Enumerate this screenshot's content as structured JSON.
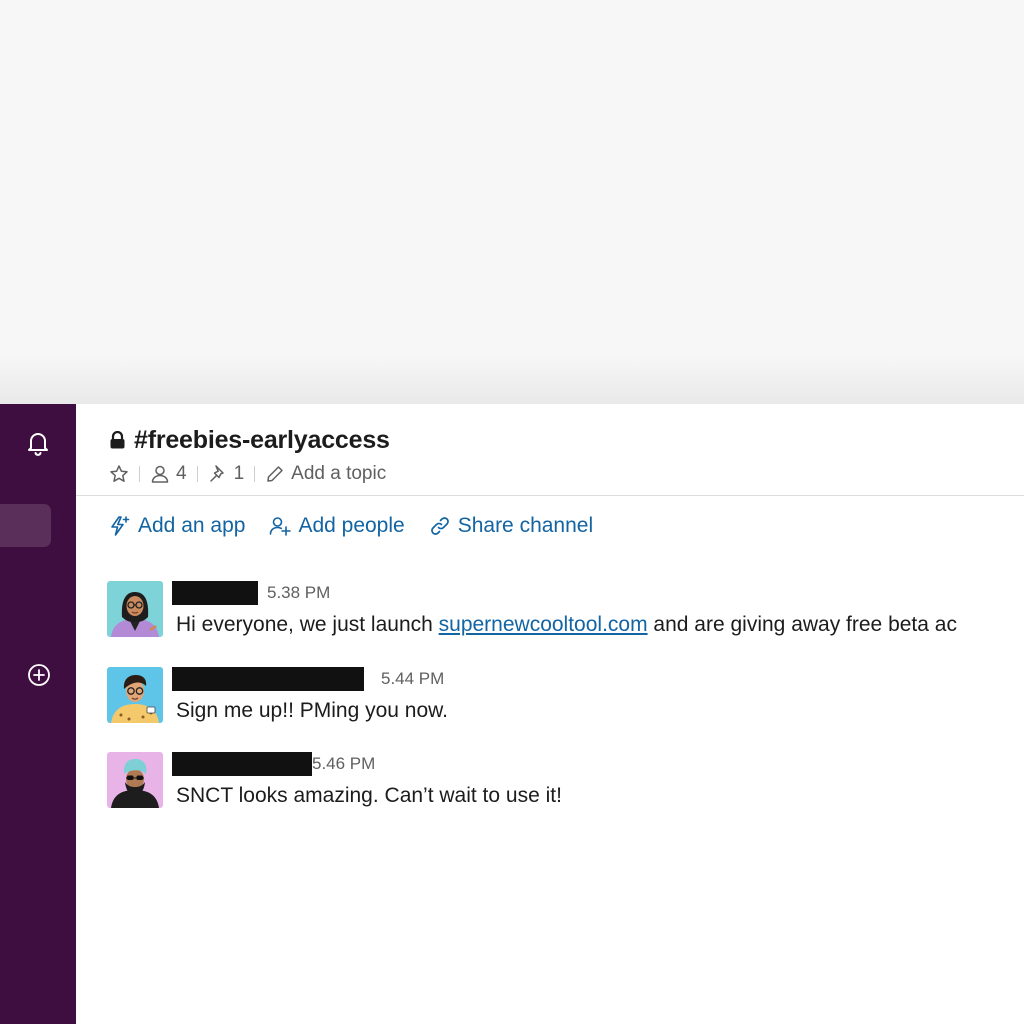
{
  "channel": {
    "name": "#freebies-earlyaccess",
    "member_count": "4",
    "pinned_count": "1",
    "topic_placeholder": "Add a topic"
  },
  "bookmarks": {
    "add_app": "Add an app",
    "add_people": "Add people",
    "share_channel": "Share channel"
  },
  "messages": [
    {
      "time": "5.38 PM",
      "text_before": "Hi everyone, we just launch ",
      "link": "supernewcooltool.com",
      "text_after": " and are giving away free beta ac"
    },
    {
      "time": "5.44 PM",
      "text": "Sign me up!!  PMing you now."
    },
    {
      "time": "5.46 PM",
      "text": "SNCT looks amazing. Can’t wait to use it!"
    }
  ],
  "icons": {
    "sidebar_top": "bell-icon",
    "sidebar_add": "add-circle-icon",
    "channel_lock": "lock-icon",
    "star": "star-icon",
    "members": "person-icon",
    "pins": "pin-icon",
    "topic": "pencil-icon",
    "add_app": "lightning-icon",
    "add_people": "add-person-icon",
    "share": "link-icon"
  },
  "colors": {
    "sidebar": "#3f0e40",
    "link": "#1264a3",
    "text": "#1d1c1d",
    "muted": "#616061"
  }
}
